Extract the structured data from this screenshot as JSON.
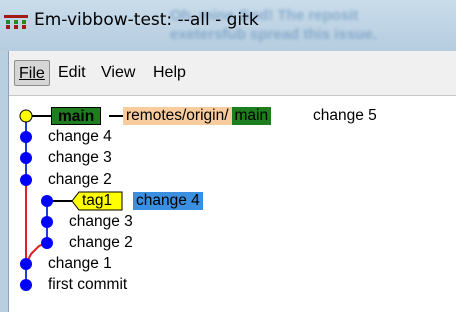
{
  "window": {
    "title": "Em-vibbow-test: --all - gitk",
    "icon": "gitk-app-icon"
  },
  "background_window": {
    "text_line1": "Oh, mine God! The reposit",
    "text_line2": "exetersfub spread this issue."
  },
  "menu": {
    "items": [
      {
        "label": "File",
        "active": true
      },
      {
        "label": "Edit",
        "active": false
      },
      {
        "label": "View",
        "active": false
      },
      {
        "label": "Help",
        "active": false
      }
    ]
  },
  "refs": {
    "head_branch": "main",
    "remote_prefix": "remotes/origin/",
    "remote_branch": "main",
    "tag": "tag1",
    "selected_commit": "change 4"
  },
  "commits": [
    {
      "message": "change 5"
    },
    {
      "message": "change 4"
    },
    {
      "message": "change 3"
    },
    {
      "message": "change 2"
    },
    {
      "message": "change 3"
    },
    {
      "message": "change 2"
    },
    {
      "message": "change 1"
    },
    {
      "message": "first commit"
    }
  ],
  "colors": {
    "head_branch_bg": "#1e7d1e",
    "remote_ref_bg": "#f8cc9c",
    "tag_bg": "#ffff00",
    "selection_bg": "#3b8fe0",
    "line_blue": "#1a3fd0",
    "line_red": "#e02020",
    "line_green": "#1e7d1e",
    "head_dot": "#ffff00",
    "commit_dot": "#0000ff"
  }
}
